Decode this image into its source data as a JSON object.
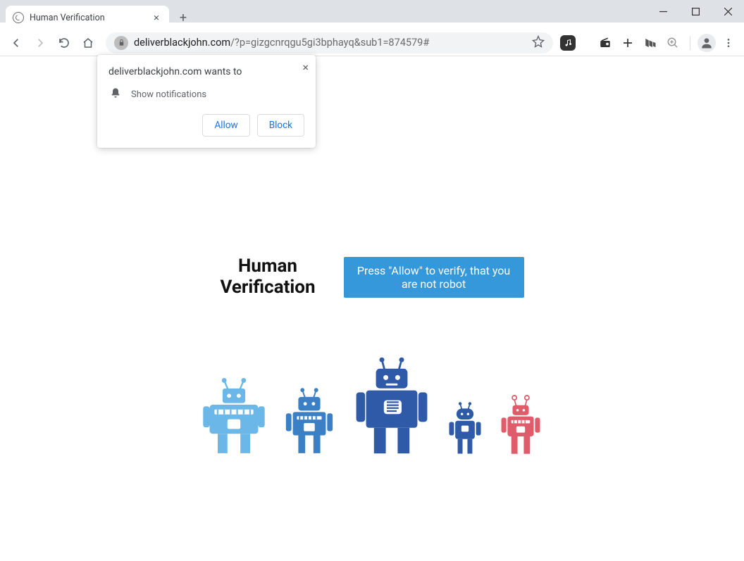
{
  "window": {
    "tab_title": "Human Verification"
  },
  "addressbar": {
    "domain": "deliverblackjohn.com",
    "path": "/?p=gizgcnrqgu5gi3bphayq&sub1=874579#"
  },
  "notification": {
    "title": "deliverblackjohn.com wants to",
    "permission_text": "Show notifications",
    "allow_label": "Allow",
    "block_label": "Block"
  },
  "page": {
    "heading_line1": "Human",
    "heading_line2": "Verification",
    "press_allow_text": "Press \"Allow\" to verify, that you are not robot"
  },
  "robots": {
    "colors": [
      "#6ab7e8",
      "#3b7fc4",
      "#2e5aa8",
      "#2e5aa8",
      "#e05c6a"
    ]
  }
}
